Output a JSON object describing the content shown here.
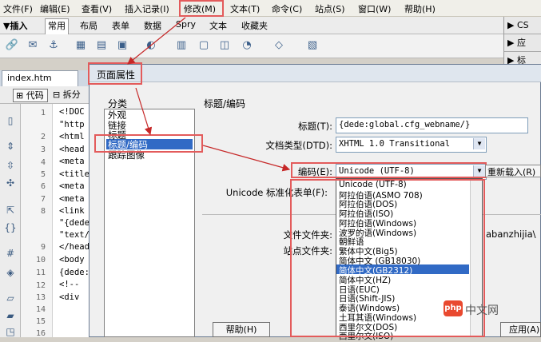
{
  "menubar": {
    "items": [
      "文件(F)",
      "编辑(E)",
      "查看(V)",
      "插入记录(I)",
      "修改(M)",
      "文本(T)",
      "命令(C)",
      "站点(S)",
      "窗口(W)",
      "帮助(H)"
    ]
  },
  "insertbar": {
    "tabs": [
      "▼插入",
      "常用",
      "布局",
      "表单",
      "数据",
      "Spry",
      "文本",
      "收藏夹"
    ]
  },
  "right_panels": {
    "items": [
      "▶ CS",
      "▶ 应",
      "▶ 标"
    ]
  },
  "document": {
    "tab": "index.htm",
    "code_button": "代码",
    "split_button": "拆分"
  },
  "gutter": {
    "lines": [
      "1",
      "",
      "2",
      "3",
      "4",
      "5",
      "6",
      "7",
      "8",
      "",
      "",
      "9",
      "10",
      "11",
      "12",
      "13",
      "14",
      "15",
      "16"
    ]
  },
  "code": {
    "lines": [
      "<!DOC",
      "\"http",
      "<html",
      "<head",
      "<meta",
      "<title",
      "<meta",
      "<meta",
      "<link",
      "\"{dede",
      "\"text/",
      "</head",
      "<body",
      "{dede:",
      "<!--",
      "<div"
    ]
  },
  "dialog": {
    "title": "页面属性",
    "category_label": "分类",
    "categories": [
      "外观",
      "链接",
      "标题",
      "标题/编码",
      "跟踪图像"
    ],
    "section_title": "标题/编码",
    "title_label": "标题(T):",
    "title_value": "{dede:global.cfg_webname/}",
    "doctype_label": "文档类型(DTD):",
    "doctype_value": "XHTML 1.0 Transitional",
    "encoding_label": "编码(E):",
    "encoding_value": "Unicode (UTF-8)",
    "reload_button": "重新载入(R)",
    "normalization_label": "Unicode 标准化表单(F):",
    "doc_folder_label": "文件文件夹:",
    "doc_folder_value": "abanzhijia\\",
    "site_folder_label": "站点文件夹:",
    "encoding_options": [
      "Unicode (UTF-8)",
      "阿拉伯语(ASMO 708)",
      "阿拉伯语(DOS)",
      "阿拉伯语(ISO)",
      "阿拉伯语(Windows)",
      "波罗的语(Windows)",
      "朝鲜语",
      "繁体中文(Big5)",
      "简体中文 (GB18030)",
      "简体中文(GB2312)",
      "简体中文(HZ)",
      "日语(EUC)",
      "日语(Shift-JIS)",
      "泰语(Windows)",
      "土耳其语(Windows)",
      "西里尔文(DOS)",
      "西里尔文(ISO)"
    ],
    "help_button": "帮助(H)",
    "apply_button": "应用(A)"
  },
  "watermark": {
    "logo": "php",
    "text": "中文网"
  },
  "colors": {
    "highlight_red": "#e35b5b",
    "selection_blue": "#316ac5"
  }
}
